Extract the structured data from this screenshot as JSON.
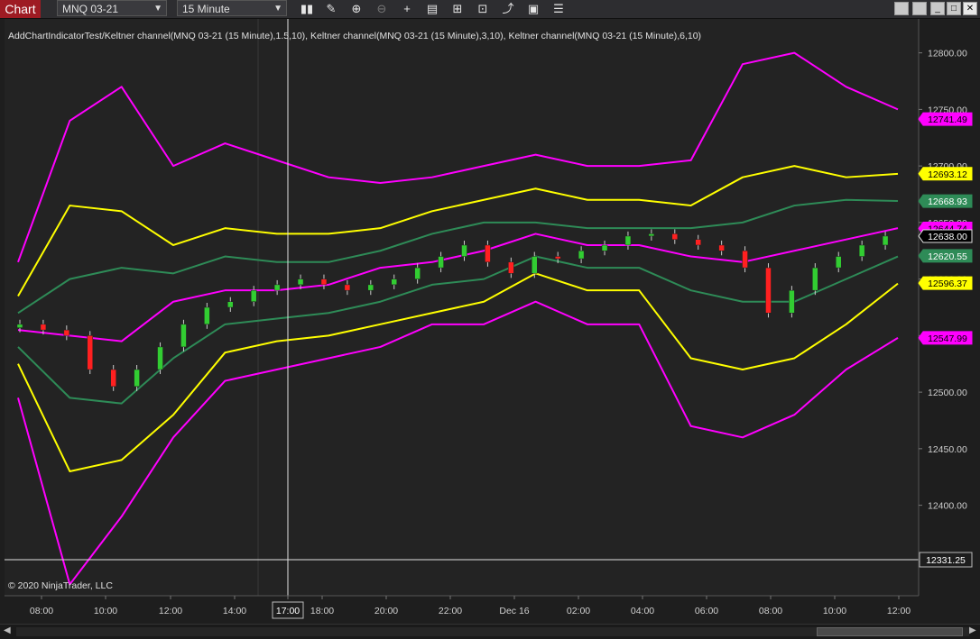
{
  "toolbar": {
    "app_title": "Chart",
    "instrument": "MNQ 03-21",
    "interval": "15 Minute",
    "icons": [
      "bar-type-icon",
      "pencil-draw-icon",
      "zoom-in-icon",
      "zoom-out-icon",
      "crosshair-icon",
      "data-box-icon",
      "strategies-icon",
      "indicators-icon",
      "chart-trader-icon",
      "properties-icon"
    ]
  },
  "window_buttons": {
    "minimize": "_",
    "restore": "",
    "maximize": "□",
    "close": "✕"
  },
  "chart": {
    "legend": "AddChartIndicatorTest/Keltner channel(MNQ 03-21 (15 Minute),1.5,10), Keltner channel(MNQ 03-21 (15 Minute),3,10), Keltner channel(MNQ 03-21 (15 Minute),6,10)",
    "copyright": "© 2020 NinjaTrader, LLC",
    "y_ticks": [
      "12800.00",
      "12750.00",
      "12700.00",
      "12650.00",
      "12600.00",
      "12550.00",
      "12500.00",
      "12450.00",
      "12400.00",
      "12350.00"
    ],
    "x_ticks": [
      "08:00",
      "10:00",
      "12:00",
      "14:00",
      "17:00",
      "18:00",
      "20:00",
      "22:00",
      "Dec 16",
      "02:00",
      "04:00",
      "06:00",
      "08:00",
      "10:00",
      "12:00"
    ],
    "crosshair_time": "17:00",
    "crosshair_price": "12331.25",
    "price_markers": [
      {
        "label": "12741.49",
        "value": 12741.49,
        "color": "#ff00ff",
        "text_color": "#000000"
      },
      {
        "label": "12693.12",
        "value": 12693.12,
        "color": "#ffff00",
        "text_color": "#000000"
      },
      {
        "label": "12668.93",
        "value": 12668.93,
        "color": "#2e8b57",
        "text_color": "#ffffff"
      },
      {
        "label": "12644.74",
        "value": 12644.74,
        "color": "#ff00ff",
        "text_color": "#000000"
      },
      {
        "label": "12638.00",
        "value": 12638.0,
        "color": "#000000",
        "text_color": "#ffffff"
      },
      {
        "label": "12620.55",
        "value": 12620.55,
        "color": "#2e8b57",
        "text_color": "#ffffff"
      },
      {
        "label": "12596.37",
        "value": 12596.37,
        "color": "#ffff00",
        "text_color": "#000000"
      },
      {
        "label": "12547.99",
        "value": 12547.99,
        "color": "#ff00ff",
        "text_color": "#000000"
      }
    ],
    "colors": {
      "up": "#32cd32",
      "down": "#ff2020",
      "band6": "#ff00ff",
      "band3": "#ffff00",
      "band15": "#2e8b57",
      "mid": "#ff00ff"
    }
  },
  "chart_data": {
    "type": "candlestick",
    "ylim": [
      12320,
      12830
    ],
    "series": [
      {
        "name": "Keltner channel(MNQ 03-21 (15 Minute),6,10) upper",
        "x": [
          0,
          10,
          20,
          30,
          40,
          50,
          60,
          70,
          80,
          90,
          100,
          110,
          120,
          130,
          140,
          150,
          160,
          170
        ],
        "values": [
          12615,
          12740,
          12770,
          12700,
          12720,
          12705,
          12690,
          12685,
          12690,
          12700,
          12710,
          12700,
          12700,
          12705,
          12790,
          12800,
          12770,
          12750
        ]
      },
      {
        "name": "Keltner channel(MNQ 03-21 (15 Minute),3,10) upper",
        "x": [
          0,
          10,
          20,
          30,
          40,
          50,
          60,
          70,
          80,
          90,
          100,
          110,
          120,
          130,
          140,
          150,
          160,
          170
        ],
        "values": [
          12585,
          12665,
          12660,
          12630,
          12645,
          12640,
          12640,
          12645,
          12660,
          12670,
          12680,
          12670,
          12670,
          12665,
          12690,
          12700,
          12690,
          12693
        ]
      },
      {
        "name": "Keltner channel(MNQ 03-21 (15 Minute),1.5,10) upper",
        "x": [
          0,
          10,
          20,
          30,
          40,
          50,
          60,
          70,
          80,
          90,
          100,
          110,
          120,
          130,
          140,
          150,
          160,
          170
        ],
        "values": [
          12570,
          12600,
          12610,
          12605,
          12620,
          12615,
          12615,
          12625,
          12640,
          12650,
          12650,
          12645,
          12645,
          12645,
          12650,
          12665,
          12670,
          12669
        ]
      },
      {
        "name": "Keltner channel middle",
        "x": [
          0,
          10,
          20,
          30,
          40,
          50,
          60,
          70,
          80,
          90,
          100,
          110,
          120,
          130,
          140,
          150,
          160,
          170
        ],
        "values": [
          12555,
          12550,
          12545,
          12580,
          12590,
          12590,
          12595,
          12610,
          12615,
          12625,
          12640,
          12630,
          12630,
          12620,
          12615,
          12625,
          12635,
          12645
        ]
      },
      {
        "name": "Keltner channel(MNQ 03-21 (15 Minute),1.5,10) lower",
        "x": [
          0,
          10,
          20,
          30,
          40,
          50,
          60,
          70,
          80,
          90,
          100,
          110,
          120,
          130,
          140,
          150,
          160,
          170
        ],
        "values": [
          12540,
          12495,
          12490,
          12530,
          12560,
          12565,
          12570,
          12580,
          12595,
          12600,
          12620,
          12610,
          12610,
          12590,
          12580,
          12580,
          12600,
          12620
        ]
      },
      {
        "name": "Keltner channel(MNQ 03-21 (15 Minute),3,10) lower",
        "x": [
          0,
          10,
          20,
          30,
          40,
          50,
          60,
          70,
          80,
          90,
          100,
          110,
          120,
          130,
          140,
          150,
          160,
          170
        ],
        "values": [
          12525,
          12430,
          12440,
          12480,
          12535,
          12545,
          12550,
          12560,
          12570,
          12580,
          12605,
          12590,
          12590,
          12530,
          12520,
          12530,
          12560,
          12596
        ]
      },
      {
        "name": "Keltner channel(MNQ 03-21 (15 Minute),6,10) lower",
        "x": [
          0,
          10,
          20,
          30,
          40,
          50,
          60,
          70,
          80,
          90,
          100,
          110,
          120,
          130,
          140,
          150,
          160,
          170
        ],
        "values": [
          12495,
          12330,
          12390,
          12460,
          12510,
          12520,
          12530,
          12540,
          12560,
          12560,
          12580,
          12560,
          12560,
          12470,
          12460,
          12480,
          12520,
          12548
        ]
      }
    ],
    "candles_close": [
      12560,
      12555,
      12550,
      12520,
      12505,
      12520,
      12540,
      12560,
      12575,
      12580,
      12590,
      12595,
      12600,
      12595,
      12590,
      12595,
      12600,
      12610,
      12620,
      12630,
      12615,
      12605,
      12620,
      12618,
      12625,
      12630,
      12638,
      12640,
      12635,
      12630,
      12625,
      12610,
      12570,
      12590,
      12610,
      12620,
      12630,
      12638
    ]
  }
}
